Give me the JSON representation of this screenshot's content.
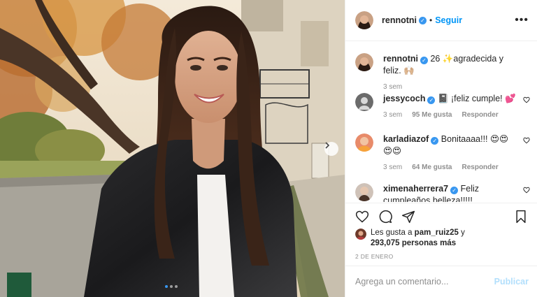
{
  "post": {
    "photo_alt": "",
    "carousel_dots": 3,
    "active_dot": 0
  },
  "header": {
    "username": "rennotni",
    "verified": true,
    "separator": "•",
    "follow_label": "Seguir",
    "more_label": "•••"
  },
  "comments": [
    {
      "username": "rennotni",
      "verified": true,
      "text": "26 ✨agradecida y feliz. 🙌🏼",
      "time": "3 sem",
      "likes": "",
      "reply": ""
    },
    {
      "username": "jessycoch",
      "verified": true,
      "text": "📓 ¡feliz cumple! 💕",
      "time": "3 sem",
      "likes": "95 Me gusta",
      "reply": "Responder"
    },
    {
      "username": "karladiazof",
      "verified": true,
      "text": "Bonitaaaa!!! 😍😍😍😍",
      "time": "3 sem",
      "likes": "64 Me gusta",
      "reply": "Responder"
    },
    {
      "username": "ximenaherrera7",
      "verified": true,
      "text": "Feliz cumpleaños belleza!!!!!",
      "time": "",
      "likes": "",
      "reply": ""
    }
  ],
  "likes": {
    "prefix": "Les gusta a",
    "user": "pam_ruiz25",
    "conjunction": "y",
    "count": "293,075 personas más"
  },
  "date": "2 DE ENERO",
  "add_comment": {
    "placeholder": "Agrega un comentario...",
    "publish_label": "Publicar"
  },
  "colors": {
    "accent": "#0095f6",
    "verified": "#3897f0",
    "publish_disabled": "#b2dffc",
    "muted": "#8e8e8e"
  }
}
